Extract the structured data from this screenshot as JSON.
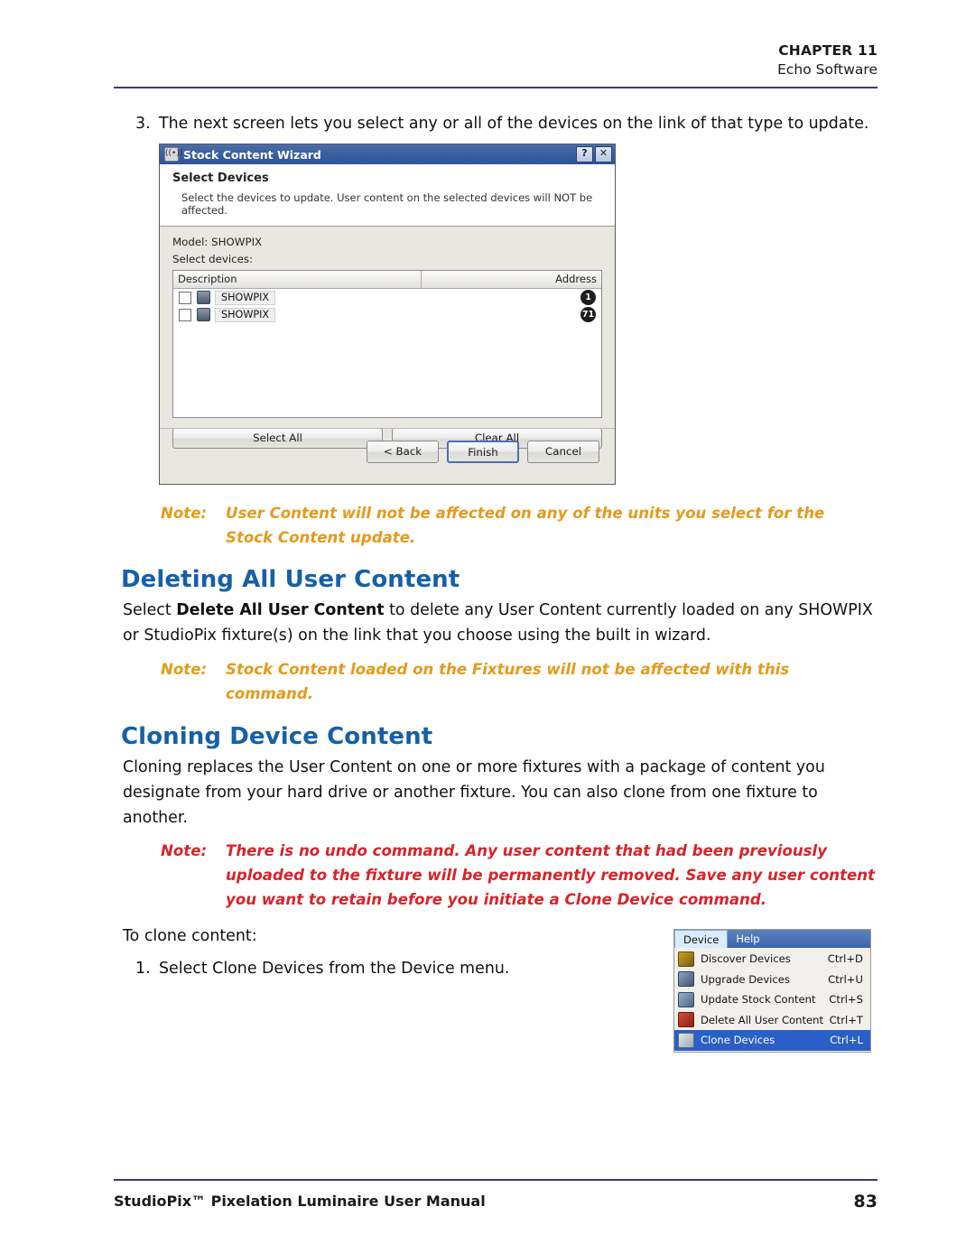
{
  "header": {
    "chapter": "CHAPTER 11",
    "subtitle": "Echo Software"
  },
  "step3": {
    "number": "3.",
    "text": "The next screen lets you select any or all of the devices on the link of that type to update."
  },
  "wizard": {
    "title": "Stock Content Wizard",
    "title_icon": "((•))",
    "help_button": "?",
    "close_button": "✕",
    "heading": "Select Devices",
    "subheading": "Select the devices to update.  User content on the selected devices will NOT be affected.",
    "model_label": "Model:",
    "model_value": "SHOWPIX",
    "select_devices_label": "Select devices:",
    "columns": [
      "Description",
      "Address"
    ],
    "devices": [
      {
        "name": "SHOWPIX",
        "address": "1"
      },
      {
        "name": "SHOWPIX",
        "address": "71"
      }
    ],
    "select_all": "Select All",
    "clear_all": "Clear All",
    "back": "< Back",
    "finish": "Finish",
    "cancel": "Cancel"
  },
  "note1": {
    "label": "Note:",
    "line1": "User Content will not be affected on any of the units you select for the",
    "line2": "Stock Content update."
  },
  "heading_deleting": "Deleting All User Content",
  "deleting_body": {
    "pre": "Select ",
    "bold": "Delete All User Content",
    "post": " to delete any User Content currently loaded on any SHOWPIX or StudioPix fixture(s) on the link that you choose using the built in wizard."
  },
  "note2": {
    "label": "Note:",
    "line1": "Stock Content loaded on the Fixtures will not be affected with this",
    "line2": "command."
  },
  "heading_cloning": "Cloning Device Content",
  "cloning_body": "Cloning replaces the User Content on one or more fixtures with a package of content you designate from your hard drive or another fixture. You can also clone from one fixture to another.",
  "note3": {
    "label": "Note:",
    "strong": "There is no undo command.",
    "line1_rest": " Any user content that had been previously",
    "line2": "uploaded to the fixture will be permanently removed. Save any user content",
    "line3": "you want to retain before you initiate a Clone Device command."
  },
  "to_clone": "To clone content:",
  "step1": {
    "number": "1.",
    "text": "Select Clone Devices from the Device menu."
  },
  "device_menu": {
    "menubar": [
      "Device",
      "Help"
    ],
    "items": [
      {
        "label": "Discover Devices",
        "shortcut": "Ctrl+D",
        "icon": "discover-icon",
        "selected": false
      },
      {
        "label": "Upgrade Devices",
        "shortcut": "Ctrl+U",
        "icon": "upgrade-icon",
        "selected": false
      },
      {
        "label": "Update Stock Content",
        "shortcut": "Ctrl+S",
        "icon": "update-stock-icon",
        "selected": false
      },
      {
        "label": "Delete All User Content",
        "shortcut": "Ctrl+T",
        "icon": "delete-icon",
        "selected": false
      },
      {
        "label": "Clone Devices",
        "shortcut": "Ctrl+L",
        "icon": "clone-icon",
        "selected": true
      }
    ]
  },
  "footer": {
    "left": "StudioPix™ Pixelation Luminaire User Manual",
    "page": "83"
  },
  "colors": {
    "heading_blue": "#1560a8",
    "note_amber": "#e49a1c",
    "note_red": "#d8232a",
    "rule_navy": "#3b3b6d",
    "menu_select_blue": "#2a5fc8"
  }
}
